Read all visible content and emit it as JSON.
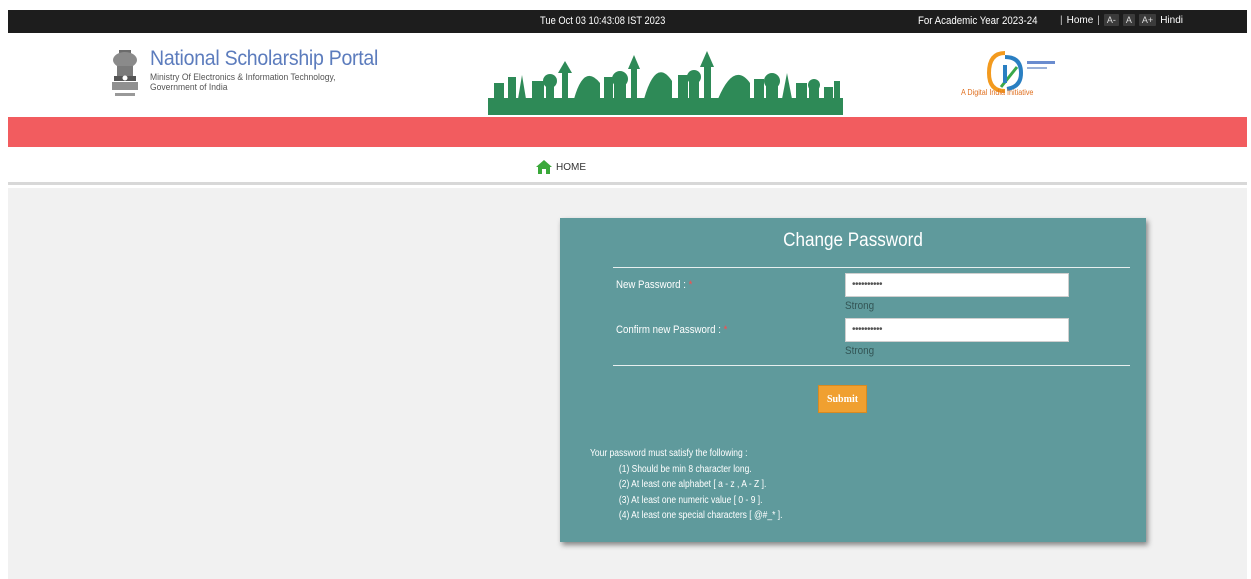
{
  "topbar": {
    "datetime": "Tue Oct 03 10:43:08 IST 2023",
    "academic_year": "For Academic Year 2023-24",
    "home_link": "Home",
    "font_decrease": "A-",
    "font_normal": "A",
    "font_increase": "A+",
    "hindi_link": "Hindi"
  },
  "header": {
    "portal_name": "National Scholarship Portal",
    "ministry": "Ministry Of Electronics & Information Technology,",
    "government": "Government of India",
    "digital_india_tagline": "A Digital India Initiative"
  },
  "nav": {
    "home_label": "HOME"
  },
  "form": {
    "title": "Change Password",
    "new_password_label": "New Password :",
    "new_password_value": "••••••••••",
    "new_password_strength": "Strong",
    "confirm_password_label": "Confirm new Password :",
    "confirm_password_value": "••••••••••",
    "confirm_password_strength": "Strong",
    "required_marker": "*",
    "submit_label": "Submit"
  },
  "rules": {
    "heading": "Your password must satisfy the following :",
    "items": [
      "(1) Should be min 8 character long.",
      "(2) At least one alphabet [ a - z , A - Z ].",
      "(3) At least one numeric value [ 0 - 9 ].",
      "(4) At least one special characters [ @#_* ]."
    ]
  },
  "colors": {
    "topbar": "#1d1d1d",
    "red_band": "#f25c5f",
    "panel": "#5f9a9c",
    "submit": "#f0a030",
    "portal_title": "#5c7cbd",
    "skyline": "#2e8a57"
  },
  "icons": {
    "emblem": "national-emblem-icon",
    "skyline": "skyline-illustration",
    "digital_india": "digital-india-logo",
    "home": "home-icon"
  }
}
